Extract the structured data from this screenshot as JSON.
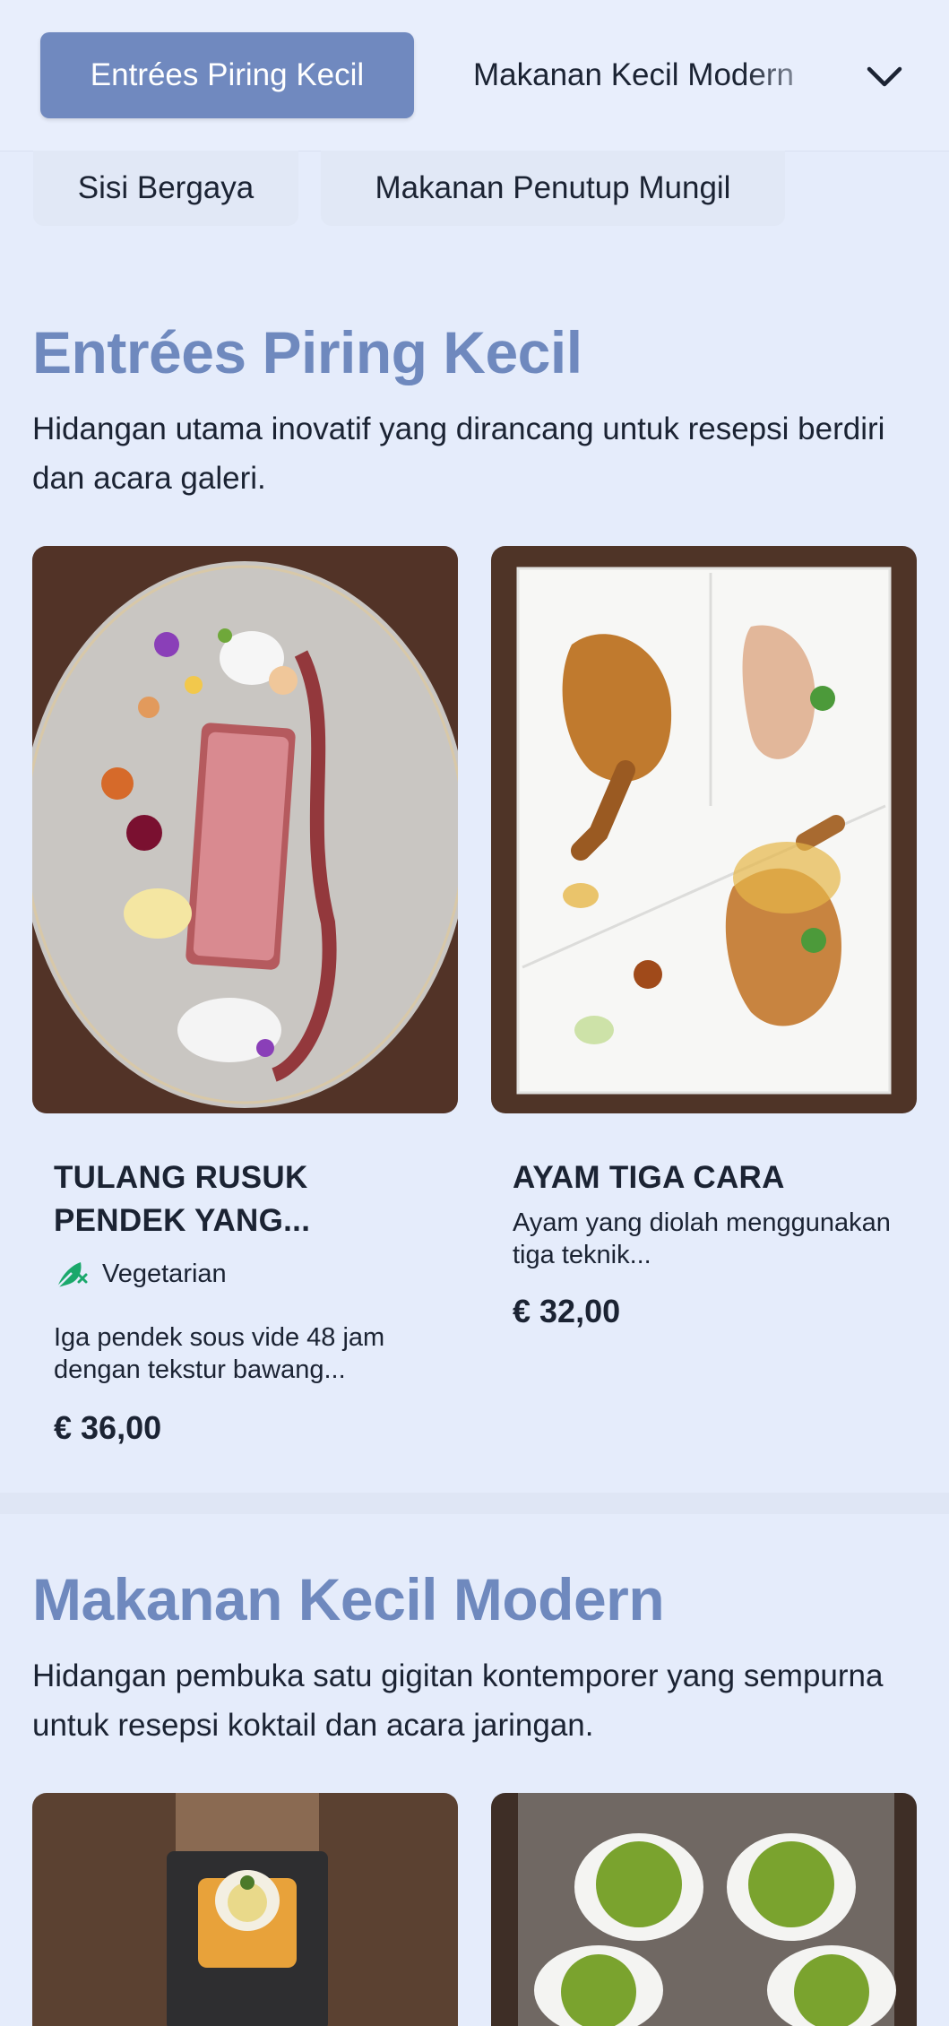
{
  "nav": {
    "active_tab": "Entrées Piring Kecil",
    "next_tab": "Makanan Kecil Modern",
    "chips": [
      "Sisi Bergaya",
      "Makanan Penutup Mungil"
    ]
  },
  "sections": [
    {
      "title": "Entrées Piring Kecil",
      "description": "Hidangan utama inovatif yang dirancang untuk resepsi berdiri dan acara galeri.",
      "items": [
        {
          "name": "TULANG RUSUK PENDEK YANG...",
          "diet_label": "Vegetarian",
          "description": "Iga pendek sous vide 48 jam dengan tekstur bawang...",
          "price": "€ 36,00"
        },
        {
          "name": "AYAM TIGA CARA",
          "description": "Ayam yang diolah menggunakan tiga teknik...",
          "price": "€ 32,00"
        }
      ]
    },
    {
      "title": "Makanan Kecil Modern",
      "description": "Hidangan pembuka satu gigitan kontemporer yang sempurna untuk resepsi koktail dan acara jaringan."
    }
  ],
  "colors": {
    "accent": "#7089bf",
    "background": "#e5ecfb",
    "vegetarian_icon": "#1aa86b"
  }
}
